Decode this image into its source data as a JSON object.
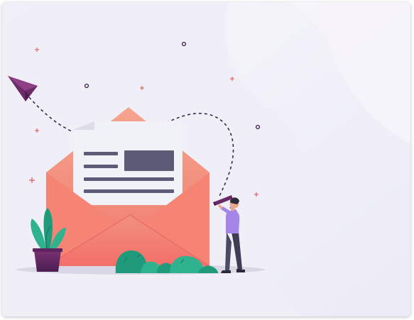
{
  "illustration": {
    "subject": "email-marketing",
    "elements": [
      "paper-plane-icon",
      "open-envelope",
      "letter",
      "person-with-telescope",
      "potted-plant",
      "bushes",
      "sparkles"
    ],
    "colors": {
      "background": "#f3f2f9",
      "envelope_front": "#f47a6c",
      "envelope_back": "#f2a08f",
      "letter": "#f1f1f8",
      "letter_lines": "#5b5b78",
      "accent_purple": "#6b2b67",
      "shirt": "#a486e8",
      "plant_green": "#2fb28e",
      "sparkle": "#e26a6a"
    }
  }
}
